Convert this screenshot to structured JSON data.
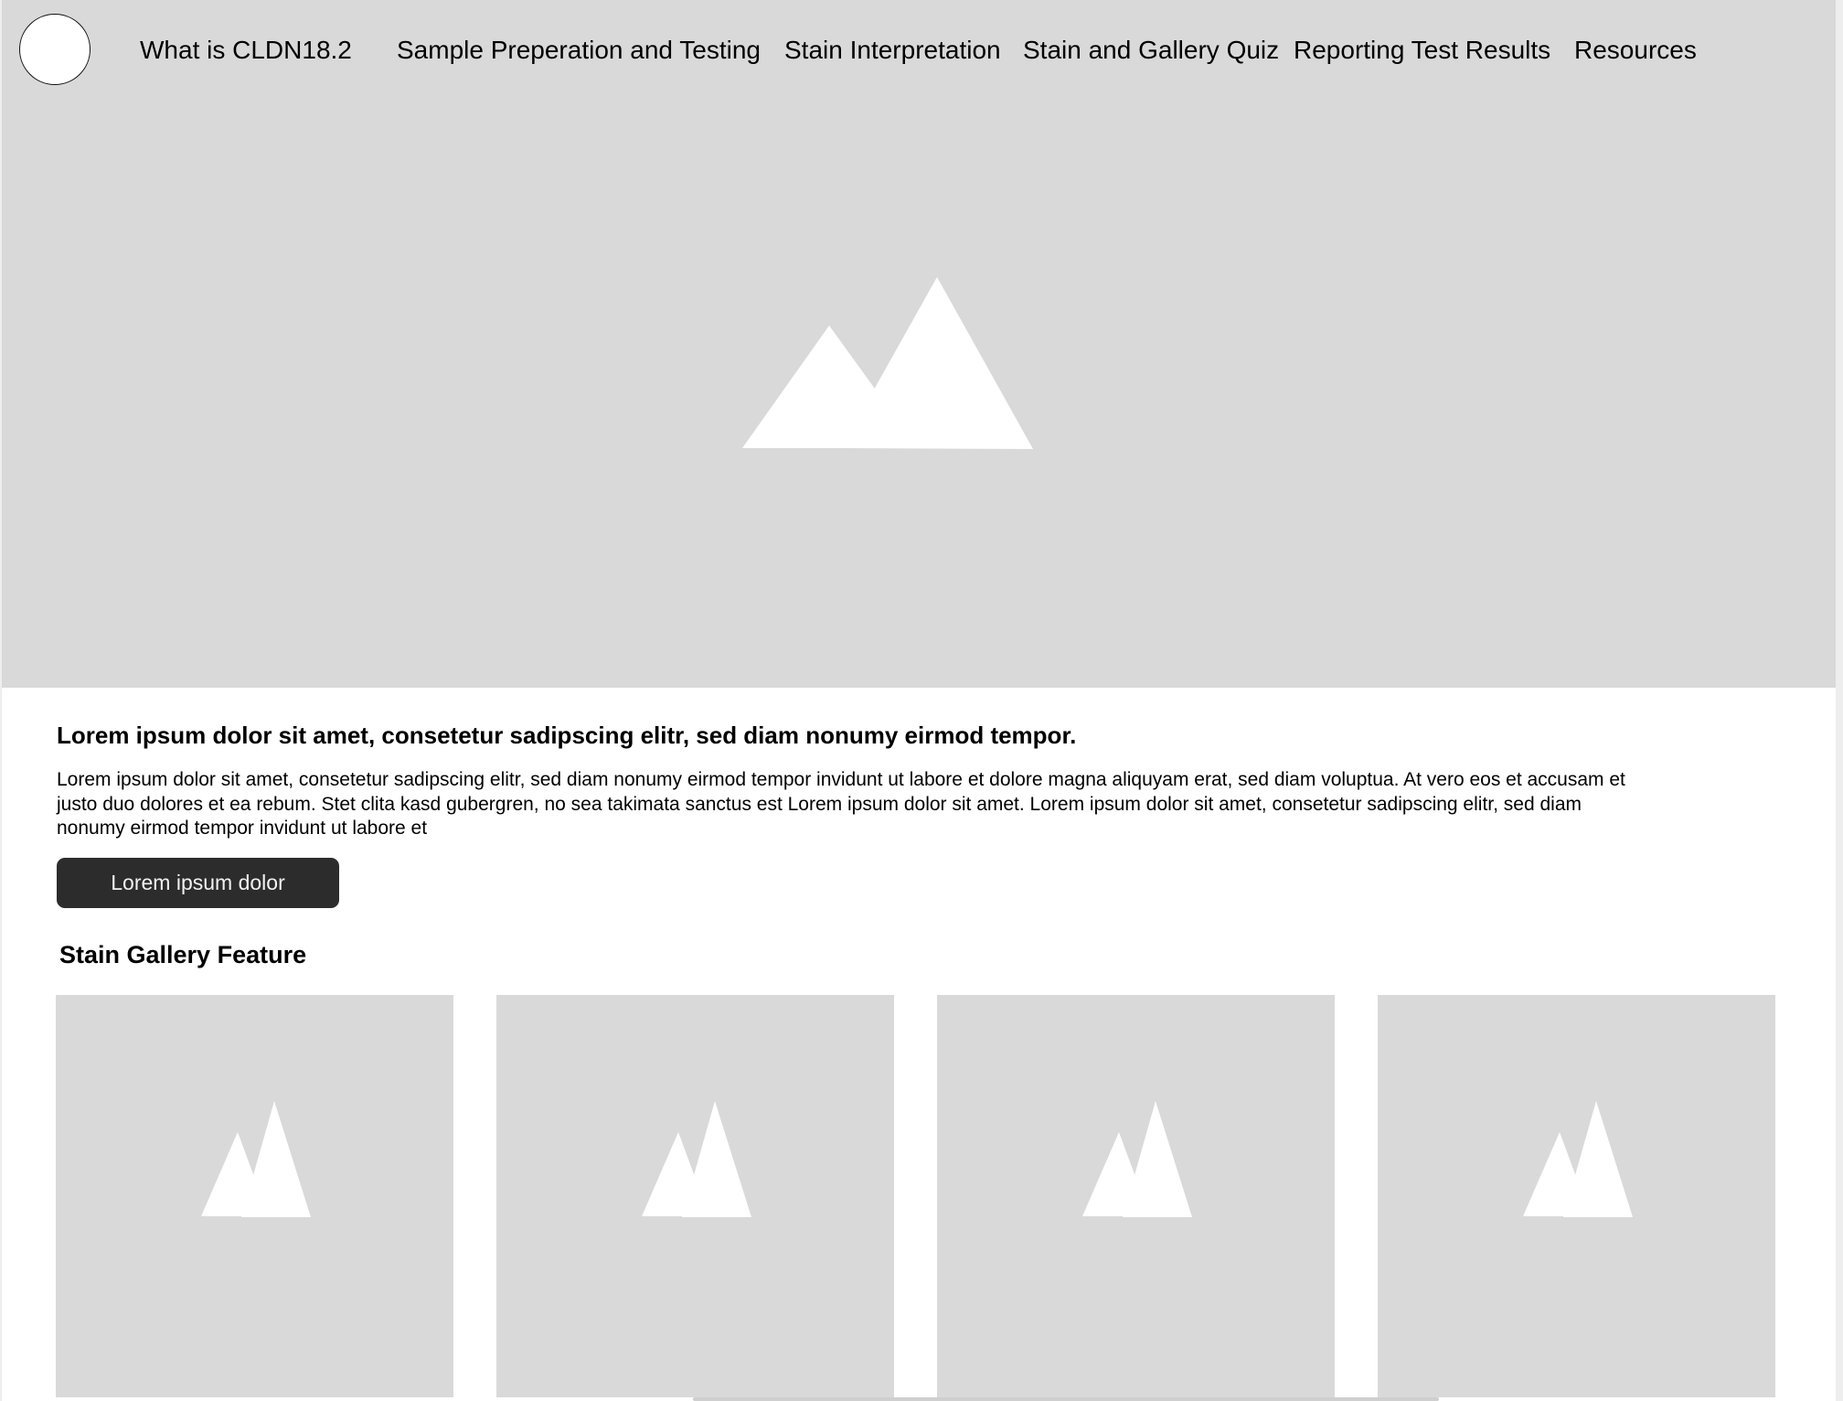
{
  "nav": {
    "logo_icon": "logo-circle-icon",
    "items": [
      {
        "label": "What is CLDN18.2"
      },
      {
        "label": "Sample Preperation and Testing"
      },
      {
        "label": "Stain Interpretation"
      },
      {
        "label": "Stain and Gallery Quiz"
      },
      {
        "label": "Reporting Test Results"
      },
      {
        "label": "Resources"
      }
    ]
  },
  "hero": {
    "image_icon": "image-placeholder-icon"
  },
  "content": {
    "headline": "Lorem ipsum dolor sit amet, consetetur sadipscing elitr, sed diam nonumy eirmod tempor.",
    "body": "Lorem ipsum dolor sit amet, consetetur sadipscing elitr, sed diam nonumy eirmod tempor invidunt ut labore et dolore magna aliquyam erat, sed diam voluptua. At vero eos et accusam et justo duo dolores et ea rebum. Stet clita kasd gubergren, no sea takimata sanctus est Lorem ipsum dolor sit amet. Lorem ipsum dolor sit amet, consetetur sadipscing elitr, sed diam nonumy eirmod tempor invidunt ut labore et",
    "cta_label": "Lorem ipsum dolor"
  },
  "gallery": {
    "title": "Stain Gallery Feature",
    "tiles": [
      {
        "icon": "image-placeholder-icon"
      },
      {
        "icon": "image-placeholder-icon"
      },
      {
        "icon": "image-placeholder-icon"
      },
      {
        "icon": "image-placeholder-icon"
      }
    ]
  },
  "colors": {
    "placeholder_gray": "#d9d9d9",
    "button_dark": "#2c2c2c",
    "page_background": "#ffffff"
  }
}
